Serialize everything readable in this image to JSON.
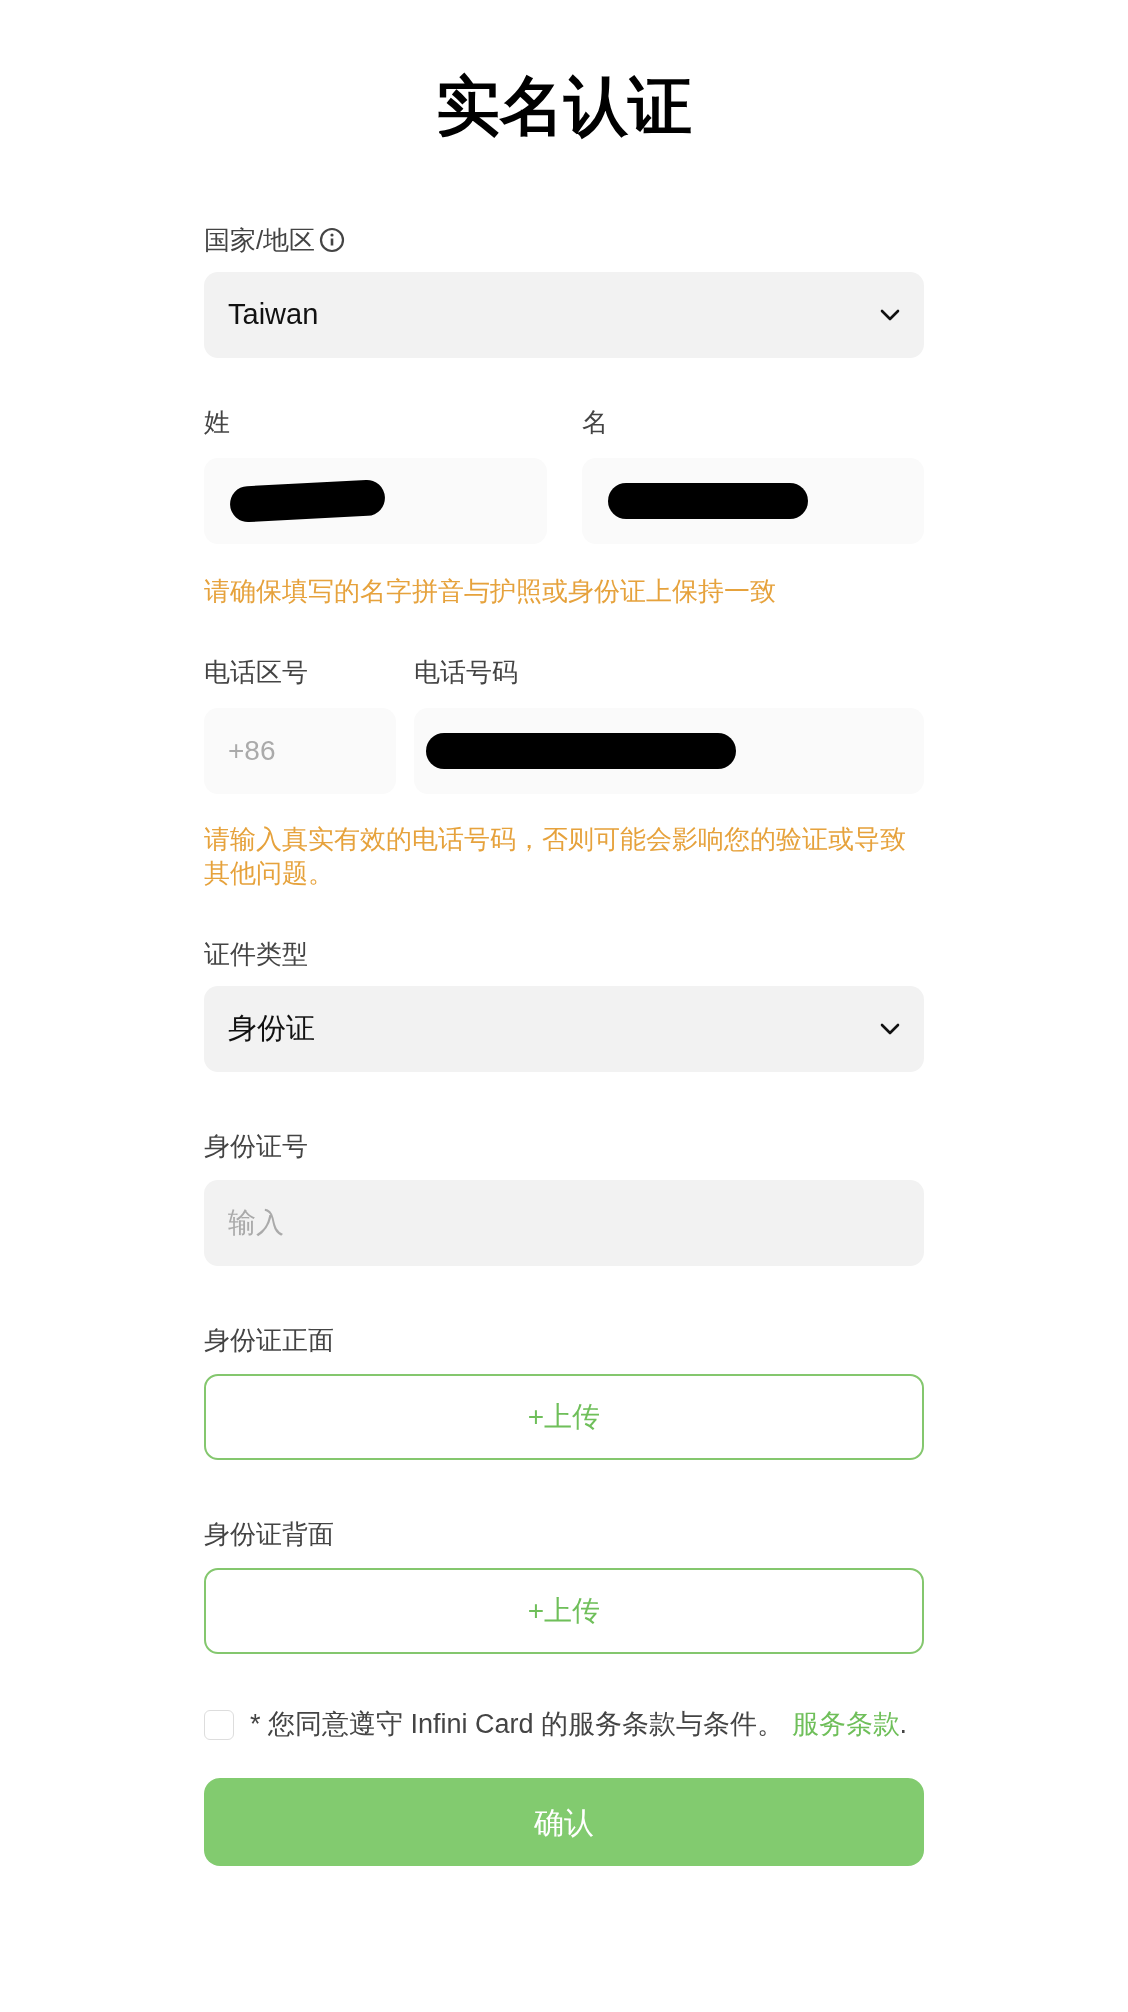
{
  "title": "实名认证",
  "country": {
    "label": "国家/地区",
    "value": "Taiwan"
  },
  "surname": {
    "label": "姓",
    "redacted": true
  },
  "given_name": {
    "label": "名",
    "redacted": true
  },
  "name_hint": "请确保填写的名字拼音与护照或身份证上保持一致",
  "phone_code": {
    "label": "电话区号",
    "placeholder": "+86"
  },
  "phone_number": {
    "label": "电话号码",
    "redacted": true
  },
  "phone_hint": "请输入真实有效的电话号码，否则可能会影响您的验证或导致其他问题。",
  "id_type": {
    "label": "证件类型",
    "value": "身份证"
  },
  "id_number": {
    "label": "身份证号",
    "placeholder": "输入"
  },
  "uploads": [
    {
      "label": "身份证正面",
      "button": "+上传"
    },
    {
      "label": "身份证背面",
      "button": "+上传"
    }
  ],
  "agreement": {
    "checked": false,
    "text": "* 您同意遵守 Infini Card 的服务条款与条件。",
    "link": "服务条款",
    "end": "."
  },
  "submit": "确认"
}
